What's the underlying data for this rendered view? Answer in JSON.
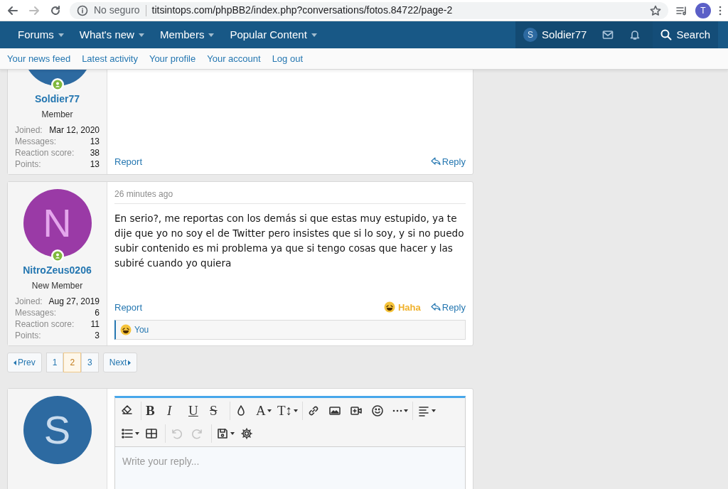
{
  "browser": {
    "security_label": "No seguro",
    "url": "titsintops.com/phpBB2/index.php?conversations/fotos.84722/page-2",
    "profile_initial": "T"
  },
  "nav": {
    "items": [
      {
        "label": "Forums"
      },
      {
        "label": "What's new"
      },
      {
        "label": "Members"
      },
      {
        "label": "Popular Content"
      }
    ],
    "user": {
      "initial": "S",
      "name": "Soldier77"
    },
    "search": "Search"
  },
  "subnav": [
    "Your news feed",
    "Latest activity",
    "Your profile",
    "Your account",
    "Log out"
  ],
  "posts": [
    {
      "author": "Soldier77",
      "online": true,
      "role": "Member",
      "stats": [
        {
          "label": "Joined:",
          "value": "Mar 12, 2020"
        },
        {
          "label": "Messages:",
          "value": "13"
        },
        {
          "label": "Reaction score:",
          "value": "38"
        },
        {
          "label": "Points:",
          "value": "13"
        }
      ],
      "report": "Report",
      "reply": "Reply"
    },
    {
      "author": "NitroZeus0206",
      "initial": "N",
      "online": true,
      "role": "New Member",
      "stats": [
        {
          "label": "Joined:",
          "value": "Aug 27, 2019"
        },
        {
          "label": "Messages:",
          "value": "6"
        },
        {
          "label": "Reaction score:",
          "value": "11"
        },
        {
          "label": "Points:",
          "value": "3"
        }
      ],
      "time": "26 minutes ago",
      "message": "En serio?, me reportas con los demás si que estas muy estupido, ya te dije que yo no soy el de Twitter pero insistes que si lo soy, y si no puedo subir contenido es mi problema ya que si tengo cosas que hacer y las subiré cuando yo quiera",
      "reaction": "Haha",
      "report": "Report",
      "reply": "Reply",
      "reactions_summary": "You"
    }
  ],
  "pagination": {
    "prev": "Prev",
    "pages": [
      {
        "label": "1",
        "selected": false
      },
      {
        "label": "2",
        "selected": true
      },
      {
        "label": "3",
        "selected": false
      }
    ],
    "next": "Next"
  },
  "reply_form": {
    "avatar_initial": "S",
    "placeholder": "Write your reply...",
    "toolbar": [
      [
        [
          {
            "kind": "eraser",
            "disabled": false,
            "dropdown": false
          }
        ],
        [
          {
            "kind": "bold",
            "label": "B",
            "disabled": false,
            "dropdown": false
          },
          {
            "kind": "italic",
            "label": "I",
            "disabled": false,
            "dropdown": false
          },
          {
            "kind": "underline",
            "label": "U",
            "disabled": false,
            "dropdown": false
          },
          {
            "kind": "strike",
            "label": "S",
            "disabled": false,
            "dropdown": false
          }
        ],
        [
          {
            "kind": "color",
            "disabled": false,
            "dropdown": false
          },
          {
            "kind": "font",
            "label": "A",
            "disabled": false,
            "dropdown": true
          },
          {
            "kind": "size",
            "label": "T↕",
            "disabled": false,
            "dropdown": true
          }
        ],
        [
          {
            "kind": "link",
            "disabled": false,
            "dropdown": false
          },
          {
            "kind": "image",
            "disabled": false,
            "dropdown": false
          },
          {
            "kind": "video",
            "disabled": false,
            "dropdown": false
          },
          {
            "kind": "smilie",
            "disabled": false,
            "dropdown": false
          },
          {
            "kind": "more",
            "disabled": false,
            "dropdown": true
          }
        ],
        [
          {
            "kind": "align",
            "disabled": false,
            "dropdown": true
          }
        ]
      ],
      [
        [
          {
            "kind": "list",
            "disabled": false,
            "dropdown": true
          },
          {
            "kind": "table",
            "disabled": false,
            "dropdown": false
          }
        ],
        [
          {
            "kind": "undo",
            "disabled": true,
            "dropdown": false
          },
          {
            "kind": "redo",
            "disabled": true,
            "dropdown": false
          }
        ],
        [
          {
            "kind": "drafts",
            "disabled": false,
            "dropdown": true
          },
          {
            "kind": "settings",
            "disabled": false,
            "dropdown": false
          }
        ]
      ]
    ]
  }
}
